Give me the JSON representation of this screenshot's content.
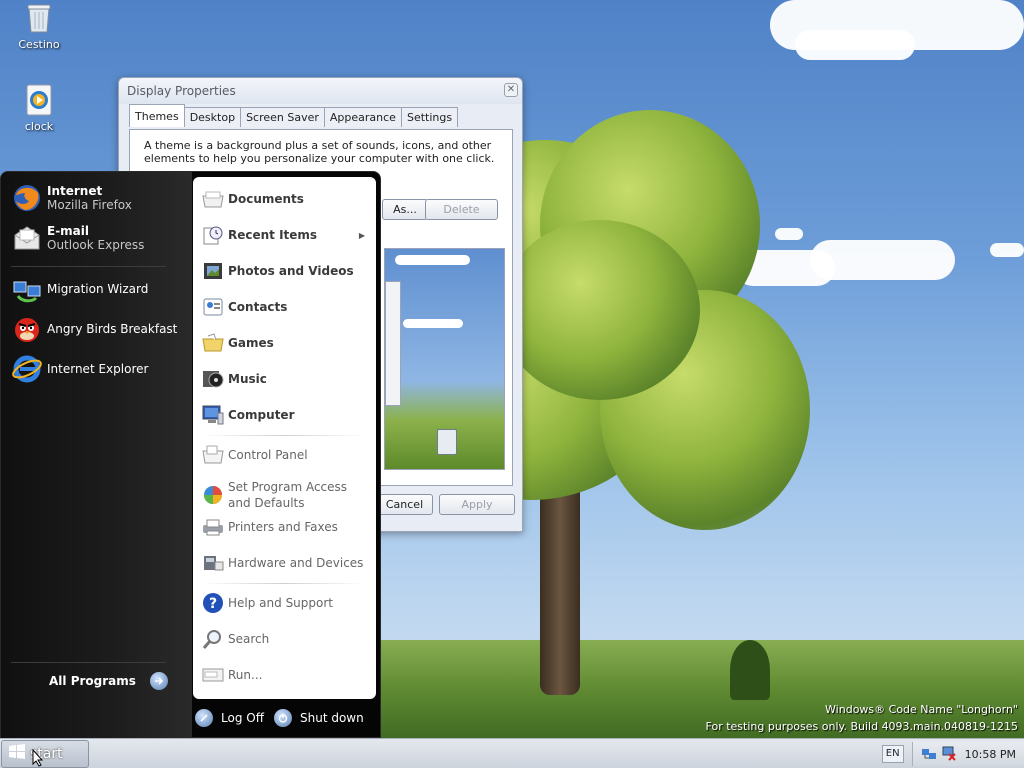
{
  "desktop": {
    "icons": [
      {
        "label": "Cestino",
        "icon": "recycle-bin-icon"
      },
      {
        "label": "clock",
        "icon": "media-player-icon"
      }
    ],
    "watermark": {
      "line1": "Windows® Code Name \"Longhorn\"",
      "line2": "For testing purposes only. Build 4093.main.040819-1215"
    }
  },
  "display_properties": {
    "title": "Display Properties",
    "tabs": [
      "Themes",
      "Desktop",
      "Screen Saver",
      "Appearance",
      "Settings"
    ],
    "active_tab": "Themes",
    "description": "A theme is a background plus a set of sounds, icons, and other elements to help you personalize your computer with one click.",
    "save_as_label": "As...",
    "delete_label": "Delete",
    "cancel_label": "Cancel",
    "apply_label": "Apply"
  },
  "start_menu": {
    "pinned": [
      {
        "title": "Internet",
        "subtitle": "Mozilla Firefox",
        "icon": "firefox-icon"
      },
      {
        "title": "E-mail",
        "subtitle": "Outlook Express",
        "icon": "mail-icon"
      }
    ],
    "recent": [
      {
        "label": "Migration Wizard",
        "icon": "migration-wizard-icon"
      },
      {
        "label": "Angry Birds Breakfast",
        "icon": "angry-bird-icon"
      },
      {
        "label": "Internet Explorer",
        "icon": "internet-explorer-icon"
      }
    ],
    "all_programs": "All Programs",
    "right_primary": [
      {
        "label": "Documents",
        "icon": "documents-icon"
      },
      {
        "label": "Recent Items",
        "icon": "recent-items-icon"
      },
      {
        "label": "Photos and Videos",
        "icon": "photos-icon"
      },
      {
        "label": "Contacts",
        "icon": "contacts-icon"
      },
      {
        "label": "Games",
        "icon": "games-icon"
      },
      {
        "label": "Music",
        "icon": "music-icon"
      },
      {
        "label": "Computer",
        "icon": "computer-icon"
      }
    ],
    "right_secondary": [
      {
        "label": "Control Panel",
        "icon": "control-panel-icon"
      },
      {
        "label": "Set Program Access and Defaults",
        "icon": "program-defaults-icon"
      },
      {
        "label": "Printers and Faxes",
        "icon": "printer-icon"
      },
      {
        "label": "Hardware and Devices",
        "icon": "hardware-icon"
      },
      {
        "label": "Help and Support",
        "icon": "help-icon"
      },
      {
        "label": "Search",
        "icon": "search-icon"
      },
      {
        "label": "Run...",
        "icon": "run-icon"
      }
    ],
    "log_off": "Log Off",
    "shut_down": "Shut down"
  },
  "taskbar": {
    "start_label": "start",
    "language": "EN",
    "time": "10:58 PM"
  }
}
